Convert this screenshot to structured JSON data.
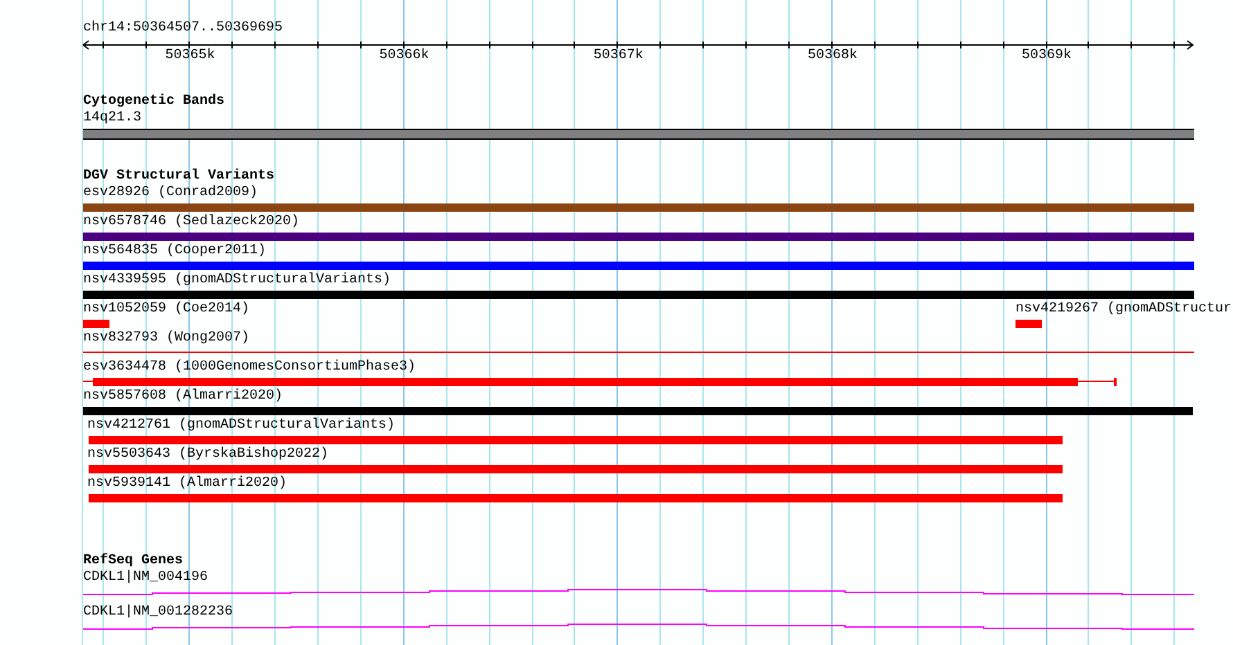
{
  "ruler": {
    "location": "chr14:50364507..50369695",
    "tick_labels": [
      "50365k",
      "50366k",
      "50367k",
      "50368k",
      "50369k"
    ]
  },
  "cytogenetic_bands": {
    "title": "Cytogenetic Bands",
    "band": {
      "label": "14q21.3",
      "color": "#808080"
    }
  },
  "dgv_structural_variants": {
    "title": "DGV Structural Variants",
    "rows": [
      {
        "features": [
          {
            "label": "esv28926 (Conrad2009)",
            "color": "#8b4513",
            "kind": "bar"
          }
        ]
      },
      {
        "features": [
          {
            "label": "nsv6578746 (Sedlazeck2020)",
            "color": "#4b0082",
            "kind": "bar"
          }
        ]
      },
      {
        "features": [
          {
            "label": "nsv564835 (Cooper2011)",
            "color": "#0000ff",
            "kind": "bar"
          }
        ]
      },
      {
        "features": [
          {
            "label": "nsv4339595 (gnomADStructuralVariants)",
            "color": "#000000",
            "kind": "bar"
          }
        ]
      },
      {
        "features": [
          {
            "label": "nsv1052059 (Coe2014)",
            "color": "#ff0000",
            "kind": "bar"
          },
          {
            "label": "nsv4219267 (gnomADStructur",
            "color": "#ff0000",
            "kind": "bar"
          }
        ]
      },
      {
        "features": [
          {
            "label": "nsv832793 (Wong2007)",
            "color": "#ff0000",
            "kind": "line"
          }
        ]
      },
      {
        "features": [
          {
            "label": "esv3634478 (1000GenomesConsortiumPhase3)",
            "color": "#ff0000",
            "kind": "bar"
          }
        ]
      },
      {
        "features": [
          {
            "label": "nsv5857608 (Almarri2020)",
            "color": "#000000",
            "kind": "bar"
          }
        ]
      },
      {
        "features": [
          {
            "label": "nsv4212761 (gnomADStructuralVariants)",
            "color": "#ff0000",
            "kind": "bar"
          }
        ]
      },
      {
        "features": [
          {
            "label": "nsv5503643 (ByrskaBishop2022)",
            "color": "#ff0000",
            "kind": "bar"
          }
        ]
      },
      {
        "features": [
          {
            "label": "nsv5939141 (Almarri2020)",
            "color": "#ff0000",
            "kind": "bar"
          }
        ]
      }
    ]
  },
  "refseq_genes": {
    "title": "RefSeq Genes",
    "genes": [
      {
        "label": "CDKL1|NM_004196",
        "color": "#ff00ff"
      },
      {
        "label": "CDKL1|NM_001282236",
        "color": "#ff00ff"
      }
    ]
  }
}
